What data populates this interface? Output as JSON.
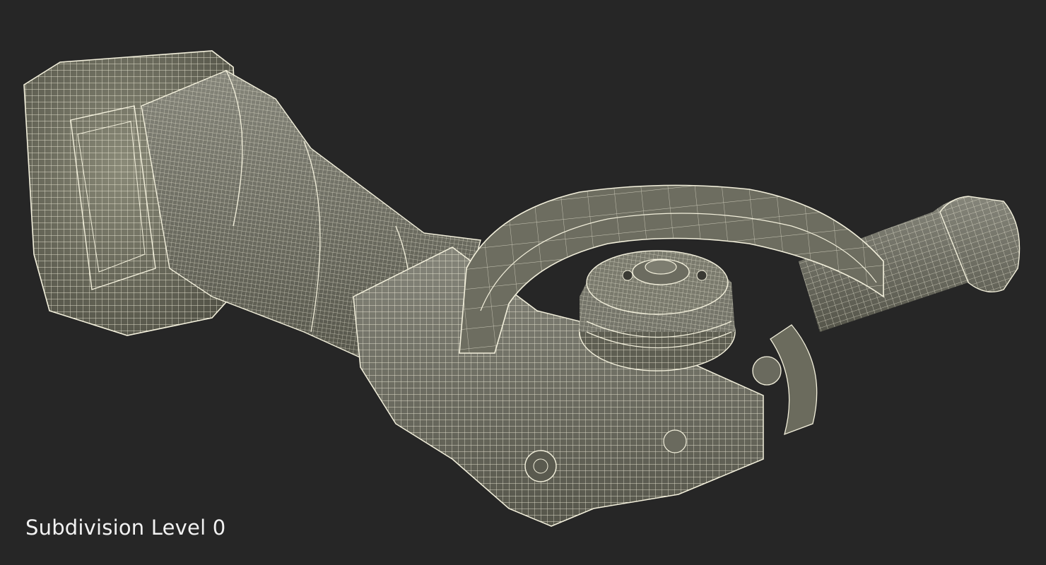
{
  "caption": {
    "text": "Subdivision Level 0"
  },
  "colors": {
    "background": "#262626",
    "surface": "#6b6b5d",
    "surface_shadow": "#4a4a40",
    "surface_light": "#8a8a78",
    "wire": "#f3f0dc",
    "caption": "#f2f2f2"
  },
  "subject": {
    "icon": "angle-grinder-wireframe"
  }
}
